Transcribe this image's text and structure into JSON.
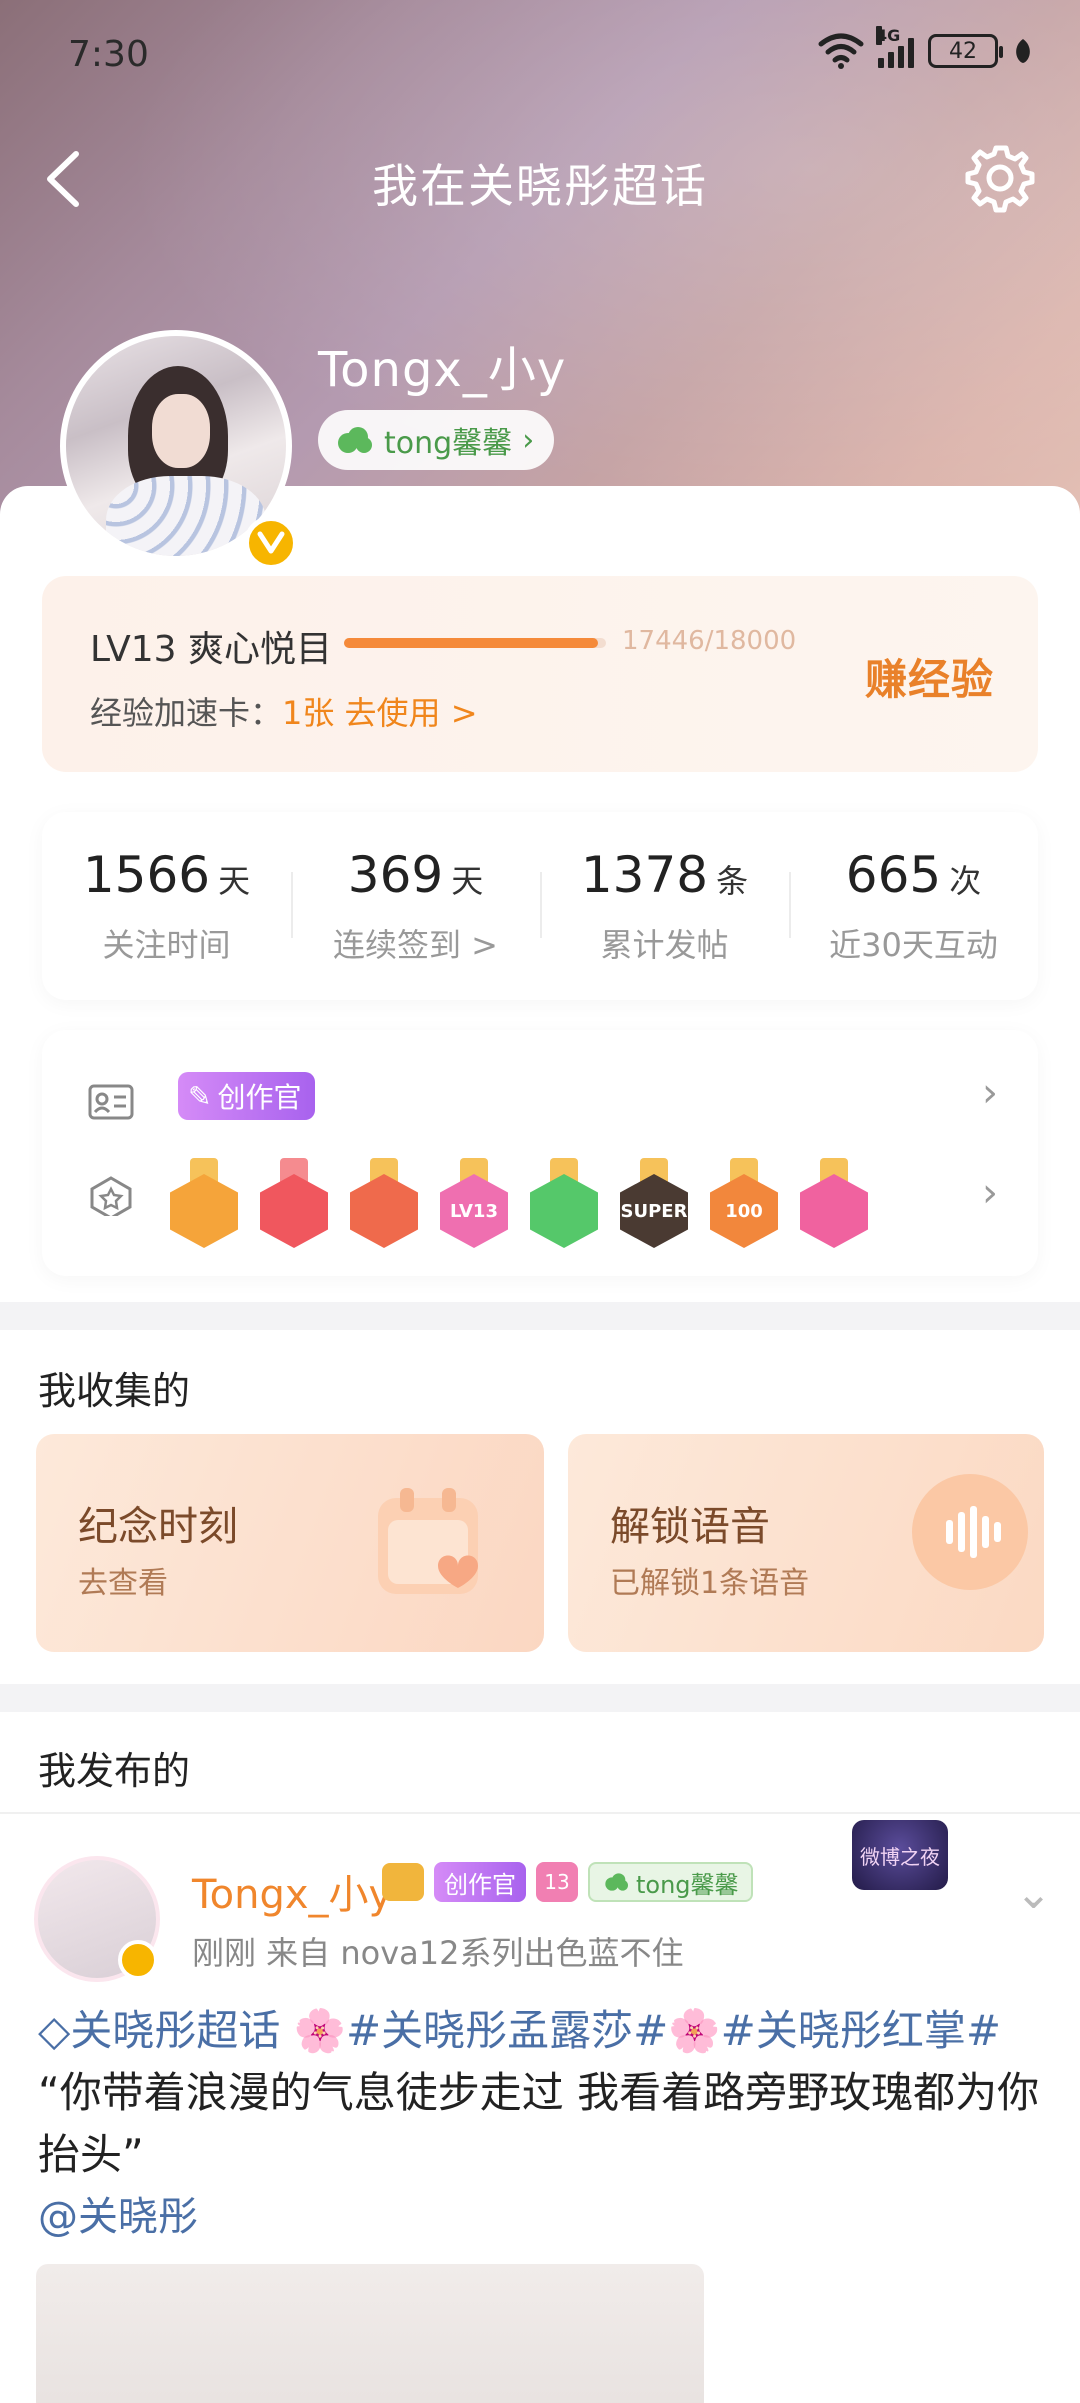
{
  "status": {
    "time": "7:30",
    "network": "4G",
    "battery": "42"
  },
  "nav": {
    "title": "我在关晓彤超话"
  },
  "profile": {
    "name": "Tongx_小y",
    "group_tag": "tong馨馨"
  },
  "level": {
    "label": "LV13 爽心悦目",
    "progress": 0.969,
    "progress_text": "17446/18000",
    "speed_label": "经验加速卡：",
    "speed_value": "1张 去使用 >",
    "earn": "赚经验"
  },
  "stats": [
    {
      "value": "1566",
      "unit": "天",
      "label": "关注时间"
    },
    {
      "value": "369",
      "unit": "天",
      "label": "连续签到 >"
    },
    {
      "value": "1378",
      "unit": "条",
      "label": "累计发帖"
    },
    {
      "value": "665",
      "unit": "次",
      "label": "近30天互动"
    }
  ],
  "badges": {
    "creator": "创作官",
    "medals": [
      {
        "name": "crown",
        "color": "#f5a43a",
        "ribbon": "#f6c25a",
        "text": ""
      },
      {
        "name": "trophy",
        "color": "#f0575e",
        "ribbon": "#f58b8f",
        "text": ""
      },
      {
        "name": "mascot",
        "color": "#ef6a4c",
        "ribbon": "#f6c25a",
        "text": ""
      },
      {
        "name": "lv13",
        "color": "#ef6fb0",
        "ribbon": "#f6c25a",
        "text": "LV13"
      },
      {
        "name": "hand",
        "color": "#55c86a",
        "ribbon": "#f6c25a",
        "text": ""
      },
      {
        "name": "super",
        "color": "#4a3a32",
        "ribbon": "#f6c25a",
        "text": "SUPER"
      },
      {
        "name": "days100",
        "color": "#f2873c",
        "ribbon": "#f6c25a",
        "text": "100"
      },
      {
        "name": "graduate",
        "color": "#f0629f",
        "ribbon": "#f6c25a",
        "text": ""
      }
    ]
  },
  "collect": {
    "title": "我收集的",
    "cards": [
      {
        "title": "纪念时刻",
        "sub": "去查看"
      },
      {
        "title": "解锁语音",
        "sub": "已解锁1条语音"
      }
    ]
  },
  "posts": {
    "title": "我发布的",
    "item": {
      "author": "Tongx_小y",
      "creator_badge": "创作官",
      "level_badge": "13",
      "group_badge": "tong馨馨",
      "corner_badge": "微博之夜",
      "meta": "刚刚  来自 nova12系列出色蓝不住",
      "topic": "关晓彤超话",
      "tag1": "#关晓彤孟露莎#",
      "tag2": "#关晓彤红掌#",
      "text": "“你带着浪漫的气息徒步走过 我看着路旁野玫瑰都为你抬头”",
      "mention": "@关晓彤"
    }
  }
}
